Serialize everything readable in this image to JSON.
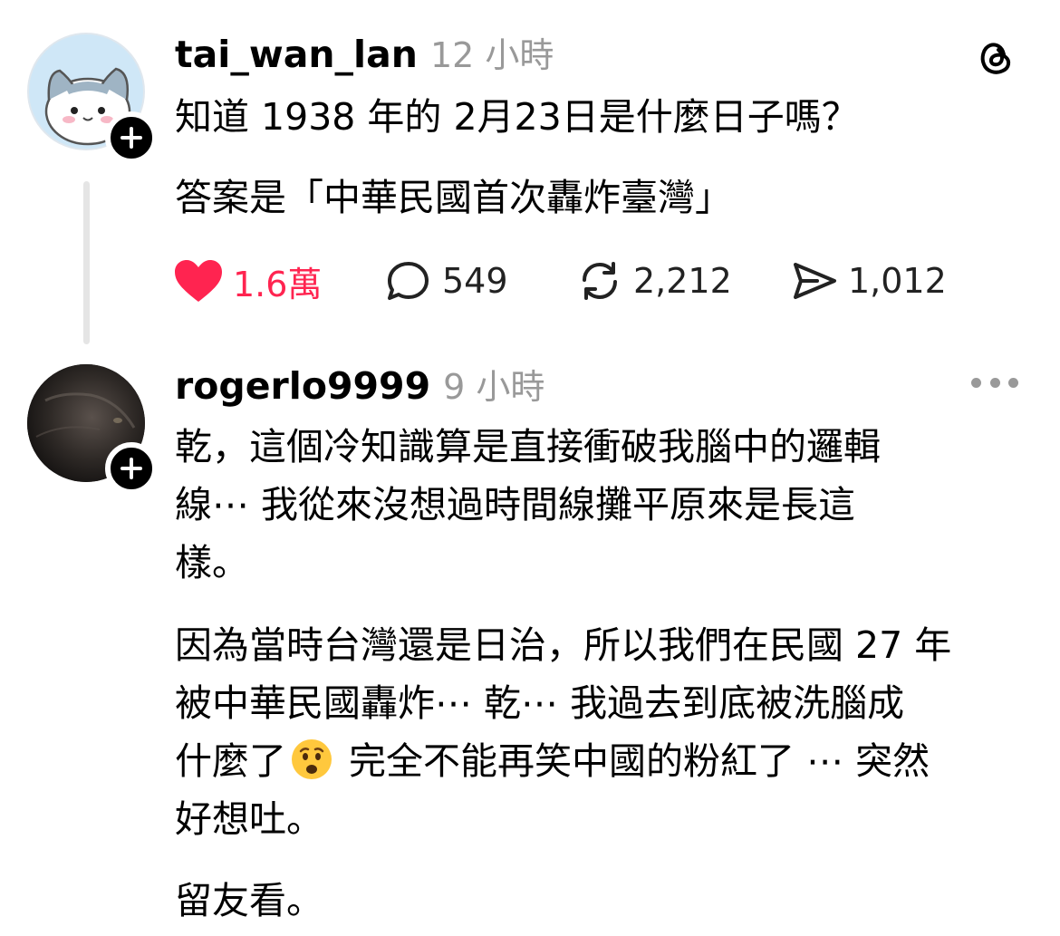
{
  "post": {
    "username": "tai_wan_lan",
    "time": "12 小時",
    "lines": [
      "知道 1938 年的 2月23日是什麼日子嗎？",
      "答案是「中華民國首次轟炸臺灣」"
    ],
    "likes": "1.6萬",
    "replies": "549",
    "reposts": "2,212",
    "shares": "1,012"
  },
  "reply": {
    "username": "rogerlo9999",
    "time": "9 小時",
    "para1": [
      "乾，這個冷知識算是直接衝破我腦中的邏輯",
      "線⋯ 我從來沒想過時間線攤平原來是長這",
      "樣。"
    ],
    "para2": [
      "因為當時台灣還是日治，所以我們在民國 27 年",
      "被中華民國轟炸⋯ 乾⋯ 我過去到底被洗腦成"
    ],
    "para2_line3_before": "什麼了",
    "para2_line3_after": " 完全不能再笑中國的粉紅了 ⋯ 突然",
    "para2_line4": "好想吐。",
    "para3": "留友看。"
  },
  "colors": {
    "like": "#ff2450",
    "muted": "#999999",
    "text": "#000000"
  },
  "icons": [
    "threads-logo-icon",
    "heart-icon",
    "reply-icon",
    "repost-icon",
    "share-icon",
    "more-icon",
    "plus-icon",
    "worried-face-emoji"
  ]
}
